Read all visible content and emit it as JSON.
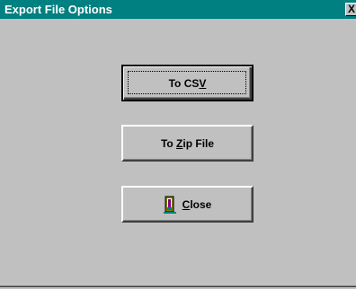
{
  "window": {
    "title": "Export File Options",
    "close_glyph": "X"
  },
  "buttons": {
    "csv": {
      "before": "To CS",
      "mnemonic": "V",
      "after": ""
    },
    "zip": {
      "before": "To ",
      "mnemonic": "Z",
      "after": "ip File"
    },
    "close": {
      "before": "",
      "mnemonic": "C",
      "after": "lose",
      "icon": "door-exit-icon"
    }
  },
  "colors": {
    "titlebar": "#008080",
    "face": "#c0c0c0"
  }
}
